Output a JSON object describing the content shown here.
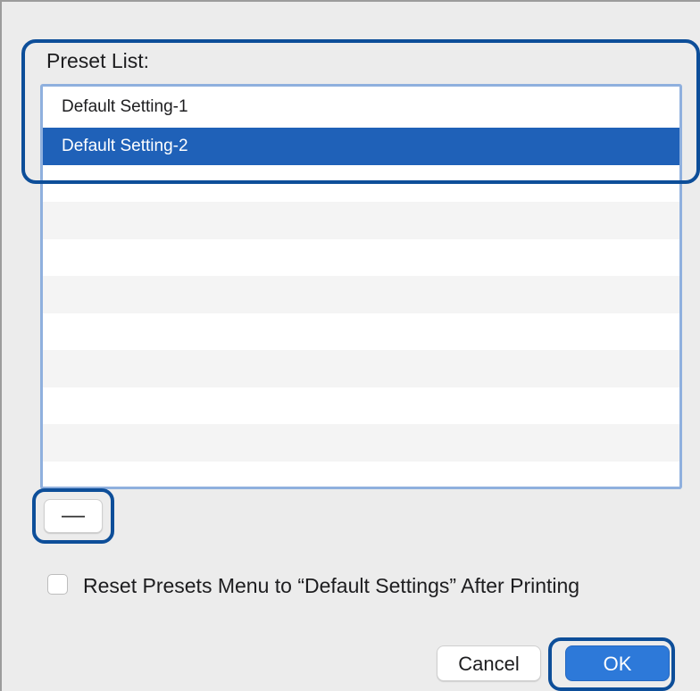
{
  "dialog": {
    "preset_list_label": "Preset List:",
    "presets": [
      {
        "label": "Default Setting-1",
        "selected": false
      },
      {
        "label": "Default Setting-2",
        "selected": true
      }
    ],
    "empty_rows": 8,
    "remove_button_label": "—",
    "reset_checkbox": {
      "label": "Reset Presets Menu to “Default Settings” After Printing",
      "checked": false
    },
    "cancel_label": "Cancel",
    "ok_label": "OK"
  },
  "colors": {
    "selection": "#1f61b8",
    "ok_button": "#2d79d9",
    "highlight_outline": "#0d4e99",
    "list_border": "#8fb0de"
  }
}
